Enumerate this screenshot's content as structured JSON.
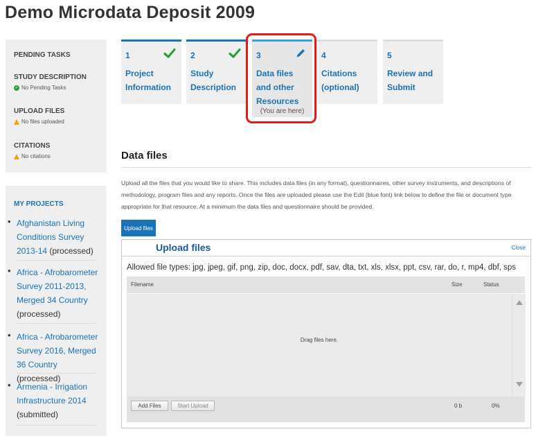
{
  "page": {
    "title": "Demo Microdata Deposit 2009"
  },
  "sidebar": {
    "pending_header": "PENDING TASKS",
    "tasks": [
      {
        "title": "STUDY DESCRIPTION",
        "status": "No Pending Tasks",
        "status_icon": "check-circle-icon",
        "status_color": "#2e9e3c"
      },
      {
        "title": "UPLOAD FILES",
        "status": "No files uploaded",
        "status_icon": "warning-icon",
        "status_color": "#f0a30a"
      },
      {
        "title": "CITATIONS",
        "status": "No citations",
        "status_icon": "warning-icon",
        "status_color": "#f0a30a"
      }
    ],
    "projects_header": "MY PROJECTS",
    "projects": [
      {
        "link": "Afghanistan Living Conditions Survey 2013-14",
        "state": "(processed)"
      },
      {
        "link": "Africa - Afrobarometer Survey 2011-2013, Merged 34 Country",
        "state": "(processed)"
      },
      {
        "link": "Africa - Afrobarometer Survey 2016, Merged 36 Country",
        "state": "(processed)"
      },
      {
        "link": "Armenia - Irrigation Infrastructure 2014",
        "state": "(submitted)"
      }
    ]
  },
  "steps": [
    {
      "num": "1",
      "label": "Project Information",
      "state": "done",
      "icon": "checkmark-icon"
    },
    {
      "num": "2",
      "label": "Study Description",
      "state": "done",
      "icon": "checkmark-icon"
    },
    {
      "num": "3",
      "label": "Data files and other Resources",
      "state": "active",
      "icon": "pencil-icon",
      "note": "(You are here)"
    },
    {
      "num": "4",
      "label": "Citations (optional)",
      "state": "pending"
    },
    {
      "num": "5",
      "label": "Review and Submit",
      "state": "pending"
    }
  ],
  "main": {
    "section_title": "Data files",
    "description": "Upload all the files that you would like to share. This includes data files (in any format), questionnaires, other survey instruments, and descriptions of methodology, program files and any reports. Once the files are uploaded please use the Edit (blue font) link below to define the file or document type appropriate for that resource. At a minimum the data files and questionnaire should be provided.",
    "upload_button": "Upload files"
  },
  "uploader": {
    "title": "Upload files",
    "close": "Close",
    "allowed": "Allowed file types: jpg, jpeg, gif, png, zip, doc, docx, pdf, sav, dta, txt, xls, xlsx, ppt, csv, rar, do, r, mp4, dbf, sps",
    "columns": {
      "filename": "Filename",
      "size": "Size",
      "status": "Status"
    },
    "drag_text": "Drag files here.",
    "add_files": "Add Files",
    "start_upload": "Start Upload",
    "total_size": "0 b",
    "total_percent": "0%"
  },
  "colors": {
    "accent": "#1a73b8",
    "highlight": "#e01b1b",
    "done_check": "#2e9e3c"
  }
}
